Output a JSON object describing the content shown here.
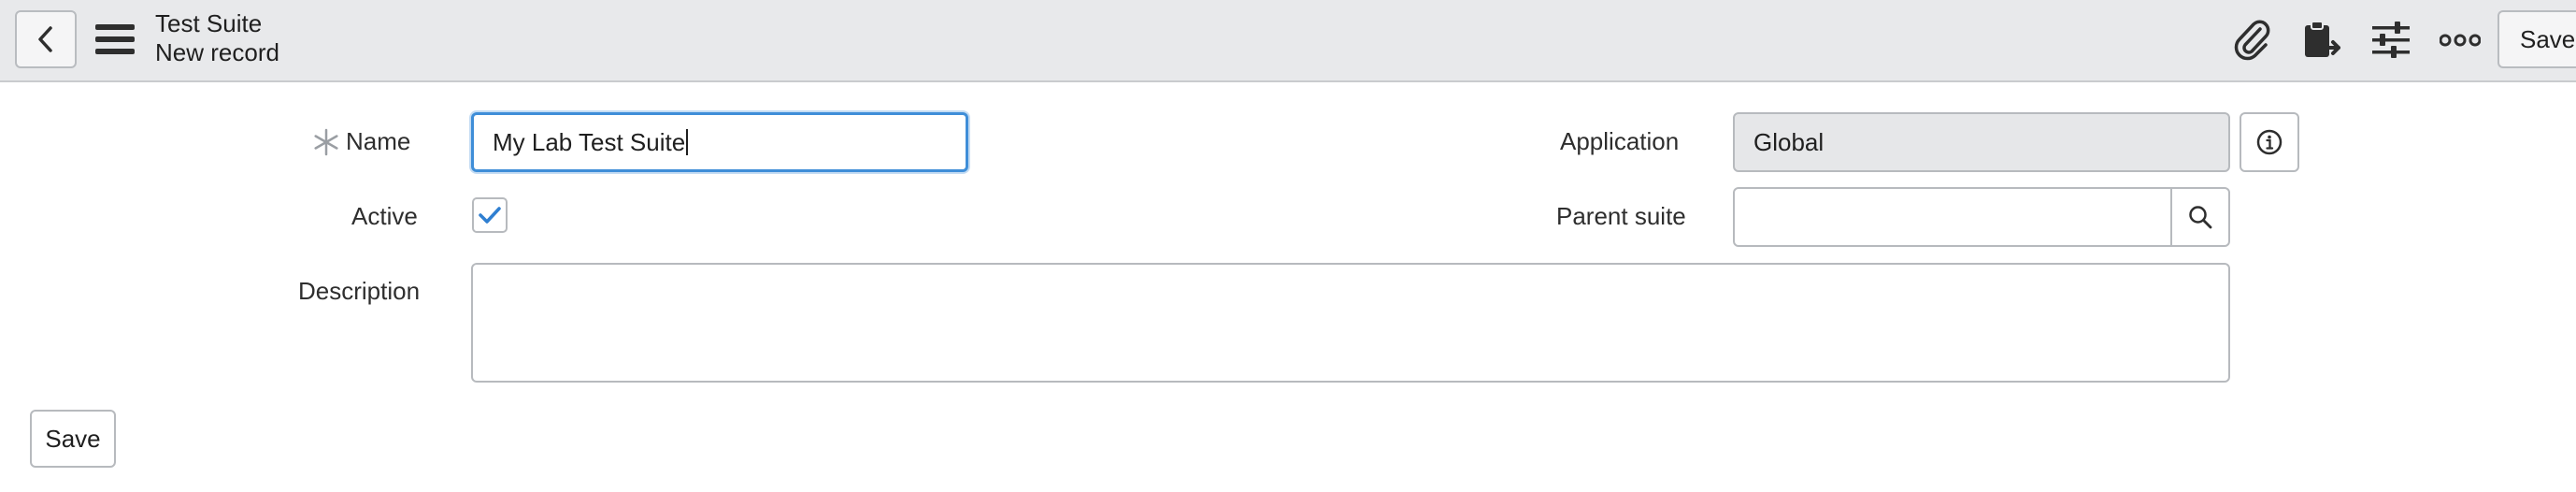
{
  "header": {
    "title": "Test Suite",
    "subtitle": "New record",
    "save_label": "Save",
    "icons": [
      "back-icon",
      "hamburger-menu-icon",
      "paperclip-icon",
      "clipboard-arrow-icon",
      "sliders-icon",
      "more-icon"
    ]
  },
  "form": {
    "name": {
      "label": "Name",
      "value": "My Lab Test Suite",
      "required": true
    },
    "active": {
      "label": "Active",
      "checked": true
    },
    "description": {
      "label": "Description",
      "value": ""
    },
    "application": {
      "label": "Application",
      "value": "Global"
    },
    "parent_suite": {
      "label": "Parent suite",
      "value": ""
    }
  },
  "footer": {
    "save_label": "Save"
  },
  "colors": {
    "header_bg": "#e8e9eb",
    "focus_blue": "#3f8ed8",
    "readonly_bg": "#e6e7e9",
    "check_blue": "#2f7fd1"
  }
}
